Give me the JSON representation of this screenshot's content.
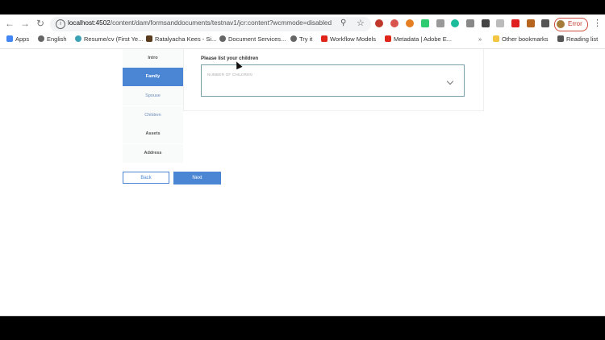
{
  "browser": {
    "url_host": "localhost:4502",
    "url_path": "/content/dam/formsanddocuments/testnav1/jcr:content?wcmmode=disabled",
    "profile_label": "Error",
    "bookmarks": [
      {
        "label": "Apps",
        "icon": "apps-grid-icon"
      },
      {
        "label": "English",
        "icon": "globe-icon"
      },
      {
        "label": "Resume/cv (First Ye...",
        "icon": "bulb-icon"
      },
      {
        "label": "Ratalyacha Kees - Si...",
        "icon": "image-icon"
      },
      {
        "label": "Document Services...",
        "icon": "globe-icon"
      },
      {
        "label": "Try it",
        "icon": "globe-icon"
      },
      {
        "label": "Workflow Models",
        "icon": "adobe-icon"
      },
      {
        "label": "Metadata | Adobe E...",
        "icon": "adobe-icon"
      },
      {
        "label": "Other bookmarks",
        "icon": "folder-icon"
      },
      {
        "label": "Reading list",
        "icon": "list-icon"
      }
    ],
    "more_bookmarks": "»"
  },
  "form": {
    "nav": [
      {
        "label": "Intro"
      },
      {
        "label": "Family"
      },
      {
        "label": "Spouse"
      },
      {
        "label": "Children"
      },
      {
        "label": "Assets"
      },
      {
        "label": "Address"
      }
    ],
    "question_label": "Please list your children",
    "dropdown_placeholder": "NUMBER OF CHILDREN",
    "back_label": "Back",
    "next_label": "Next"
  },
  "colors": {
    "accent": "#4b86d4"
  }
}
